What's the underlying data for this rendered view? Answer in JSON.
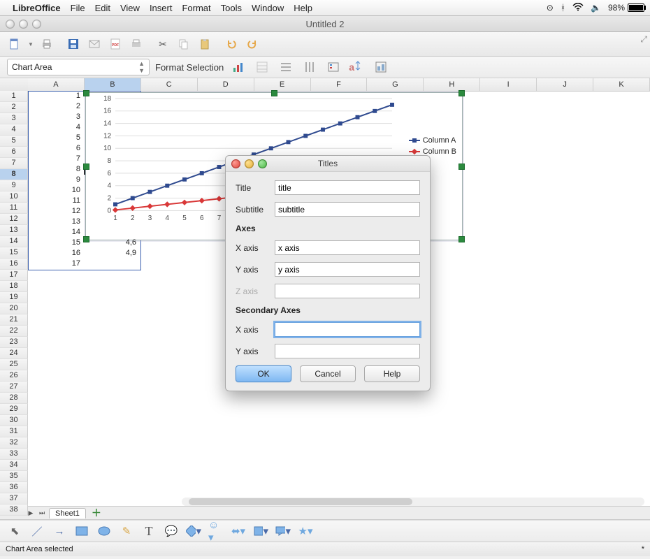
{
  "menubar": {
    "app": "LibreOffice",
    "items": [
      "File",
      "Edit",
      "View",
      "Insert",
      "Format",
      "Tools",
      "Window",
      "Help"
    ],
    "battery_pct": "98%"
  },
  "window": {
    "title": "Untitled 2"
  },
  "chart_toolbar": {
    "dropdown_value": "Chart Area",
    "format_label": "Format Selection"
  },
  "columns": [
    "A",
    "B",
    "C",
    "D",
    "E",
    "F",
    "G",
    "H",
    "I",
    "J",
    "K"
  ],
  "rows_total": 38,
  "selected_row": 8,
  "selected_col": 1,
  "cells_a": [
    1,
    2,
    3,
    4,
    5,
    6,
    7,
    8,
    9,
    10,
    11,
    12,
    13,
    14,
    15,
    16,
    17
  ],
  "cells_b_visible": {
    "15": "4,6",
    "16": "4,9"
  },
  "legend": {
    "a": "Column A",
    "b": "Column B"
  },
  "sheet_tab": "Sheet1",
  "status": {
    "left": "Chart Area selected",
    "right": "*"
  },
  "dialog": {
    "title": "Titles",
    "title_label": "Title",
    "title_val": "title",
    "subtitle_label": "Subtitle",
    "subtitle_val": "subtitle",
    "axes_h": "Axes",
    "xaxis_label": "X axis",
    "xaxis_val": "x axis",
    "yaxis_label": "Y axis",
    "yaxis_val": "y axis",
    "zaxis_label": "Z axis",
    "zaxis_val": "",
    "sec_h": "Secondary Axes",
    "sec_x_label": "X axis",
    "sec_x_val": "",
    "sec_y_label": "Y axis",
    "sec_y_val": "",
    "ok": "OK",
    "cancel": "Cancel",
    "help": "Help"
  },
  "chart_data": {
    "type": "line",
    "x": [
      1,
      2,
      3,
      4,
      5,
      6,
      7,
      8,
      9,
      10,
      11,
      12,
      13,
      14,
      15,
      16,
      17
    ],
    "series": [
      {
        "name": "Column A",
        "color": "#2f4a8f",
        "values": [
          1,
          2,
          3,
          4,
          5,
          6,
          7,
          8,
          9,
          10,
          11,
          12,
          13,
          14,
          15,
          16,
          17
        ]
      },
      {
        "name": "Column B",
        "color": "#d93838",
        "values": [
          0.1,
          0.4,
          0.7,
          1.0,
          1.3,
          1.6,
          1.9,
          2.2,
          2.5,
          2.8,
          3.1,
          3.4,
          3.7,
          4.0,
          4.3,
          4.6,
          4.9
        ]
      }
    ],
    "ylim": [
      0,
      18
    ],
    "yticks": [
      0,
      2,
      4,
      6,
      8,
      10,
      12,
      14,
      16,
      18
    ],
    "xlabel": "",
    "ylabel": "",
    "title": ""
  }
}
